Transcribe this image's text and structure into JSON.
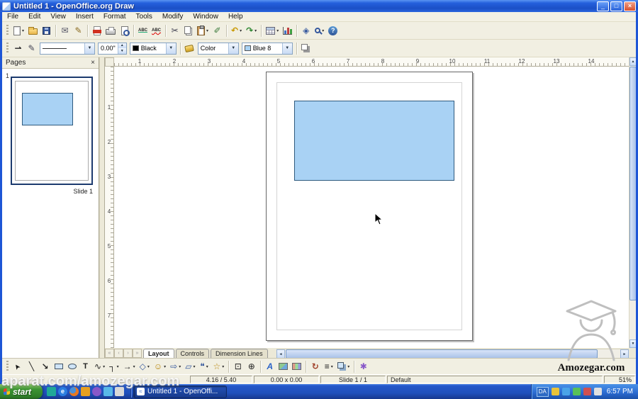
{
  "window": {
    "title": "Untitled 1 - OpenOffice.org Draw"
  },
  "menu": {
    "items": [
      "File",
      "Edit",
      "View",
      "Insert",
      "Format",
      "Tools",
      "Modify",
      "Window",
      "Help"
    ]
  },
  "standard_toolbar": {
    "icon_names": [
      "new-document",
      "open",
      "save",
      "document-as-email",
      "edit-file",
      "export-pdf",
      "print",
      "page-preview",
      "spellcheck",
      "auto-spellcheck",
      "cut",
      "copy",
      "paste",
      "format-paintbrush",
      "undo",
      "redo",
      "insert-table",
      "insert-chart",
      "navigator",
      "zoom",
      "help"
    ]
  },
  "line_fill_toolbar": {
    "icon_names": [
      "arrow-style",
      "line-style-pen",
      "area-fill-can",
      "shadow"
    ],
    "line_width_value": "0.00\"",
    "line_color_value": "Black",
    "fill_type_value": "Color",
    "fill_color_value": "Blue 8"
  },
  "pages_panel": {
    "title": "Pages",
    "page_number": "1",
    "slide_label": "Slide 1"
  },
  "ruler": {
    "h_numbers": [
      1,
      2,
      3,
      4,
      5,
      6,
      7,
      8,
      9,
      10,
      11,
      12,
      13,
      14
    ],
    "v_numbers": [
      1,
      2,
      3,
      4,
      5,
      6,
      7
    ]
  },
  "canvas": {
    "shape_fill_color": "#A9D2F4",
    "shape_border_color": "#2E5A7E"
  },
  "tab_bar": {
    "tabs": [
      "Layout",
      "Controls",
      "Dimension Lines"
    ],
    "active_tab": "Layout"
  },
  "drawing_toolbar": {
    "icon_names": [
      "select",
      "line",
      "line-ends-arrow",
      "rectangle",
      "ellipse",
      "text",
      "curve",
      "connector",
      "lines-and-arrows",
      "basic-shapes",
      "symbol-shapes",
      "block-arrows",
      "flowcharts",
      "callouts",
      "stars",
      "edit-points",
      "glue-points",
      "fontwork",
      "from-file",
      "gallery",
      "rotate",
      "alignment",
      "arrange",
      "interaction"
    ]
  },
  "status_bar": {
    "cursor_position": "4.16 / 5.40",
    "object_size": "0.00 x 0.00",
    "slide_info": "Slide 1 / 1",
    "style_name": "Default",
    "zoom_level": "51%"
  },
  "taskbar": {
    "start_label": "start",
    "task_button_label": "Untitled 1 - OpenOffi...",
    "language_indicator": "DA",
    "clock": "6:57 PM"
  },
  "watermark": {
    "overlay_text": "aparat.com/amozegar.com",
    "brand_text": "Amozegar.com"
  }
}
